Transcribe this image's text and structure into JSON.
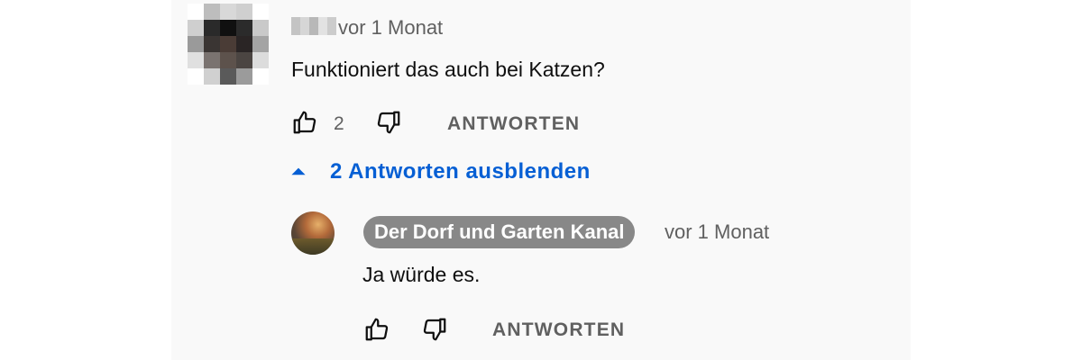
{
  "comment": {
    "timestamp": "vor 1 Monat",
    "text": "Funktioniert das auch bei Katzen?",
    "like_count": "2",
    "reply_label": "ANTWORTEN",
    "like_icon": "thumb-up-icon",
    "dislike_icon": "thumb-down-icon"
  },
  "replies_toggle": {
    "label": "2 Antworten ausblenden",
    "icon": "caret-up-icon"
  },
  "reply": {
    "author": "Der Dorf und Garten Kanal",
    "timestamp": "vor 1 Monat",
    "text": "Ja würde es.",
    "reply_label": "ANTWORTEN"
  },
  "colors": {
    "accent": "#065fd4",
    "badge_bg": "#888888",
    "panel_bg": "#f9f9f9"
  }
}
